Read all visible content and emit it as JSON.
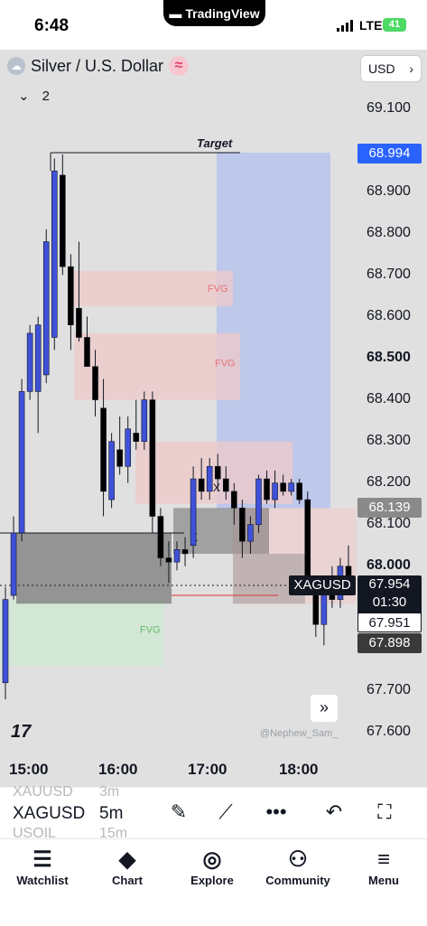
{
  "status_bar": {
    "time": "6:48",
    "app_pill": "TradingView",
    "network": "LTE",
    "battery": "41"
  },
  "chart_header": {
    "symbol_title": "Silver / U.S. Dollar",
    "indicator_count": "2",
    "currency": "USD"
  },
  "price_axis": {
    "labels": [
      "69.100",
      "68.900",
      "68.800",
      "68.700",
      "68.600",
      "68.500",
      "68.400",
      "68.300",
      "68.200",
      "68.100",
      "68.000",
      "67.700",
      "67.600"
    ],
    "tags": {
      "target": "68.994",
      "upper": "68.139",
      "symbol": "XAGUSD",
      "current": "67.954",
      "countdown": "01:30",
      "crosshair": "67.951",
      "lower": "67.898"
    }
  },
  "time_axis": {
    "labels": [
      "15:00",
      "16:00",
      "17:00",
      "18:00"
    ]
  },
  "drawings": {
    "target_label": "Target",
    "fvg_labels": [
      "FVG",
      "FVG",
      "FVG"
    ],
    "x_markers": [
      "X",
      "X"
    ]
  },
  "watermark": "@Nephew_Sam_",
  "toolbar": {
    "symbol": "XAGUSD",
    "interval": "5m",
    "ghost_above_symbol": "XAUUSD",
    "ghost_above_interval": "3m",
    "ghost_below_symbol": "USOIL",
    "ghost_below_interval": "15m"
  },
  "nav": {
    "items": [
      "Watchlist",
      "Chart",
      "Explore",
      "Community",
      "Menu"
    ]
  },
  "colors": {
    "bull": "#3f51d8",
    "bear": "#000000",
    "target_zone": "#b7c3ec",
    "fvg_red": "#efcaca",
    "fvg_green": "#cfe8d3",
    "symbol_tag": "#131722",
    "upper_tag": "#8a8a8a",
    "target_tag": "#2962ff"
  },
  "chart_data": {
    "type": "candlestick",
    "x_ticks": [
      "15:00",
      "16:00",
      "17:00",
      "18:00"
    ],
    "y_range": [
      67.6,
      69.15
    ],
    "candles": [
      {
        "o": 67.72,
        "h": 67.95,
        "l": 67.68,
        "c": 67.92
      },
      {
        "o": 67.93,
        "h": 68.12,
        "l": 67.92,
        "c": 68.08
      },
      {
        "o": 68.08,
        "h": 68.45,
        "l": 68.06,
        "c": 68.42
      },
      {
        "o": 68.42,
        "h": 68.58,
        "l": 68.4,
        "c": 68.56
      },
      {
        "o": 68.42,
        "h": 68.6,
        "l": 68.32,
        "c": 68.58
      },
      {
        "o": 68.46,
        "h": 68.81,
        "l": 68.44,
        "c": 68.78
      },
      {
        "o": 68.55,
        "h": 68.98,
        "l": 68.52,
        "c": 68.95
      },
      {
        "o": 68.94,
        "h": 68.99,
        "l": 68.7,
        "c": 68.72
      },
      {
        "o": 68.72,
        "h": 68.75,
        "l": 68.52,
        "c": 68.58
      },
      {
        "o": 68.62,
        "h": 68.78,
        "l": 68.54,
        "c": 68.55
      },
      {
        "o": 68.55,
        "h": 68.6,
        "l": 68.48,
        "c": 68.48
      },
      {
        "o": 68.48,
        "h": 68.52,
        "l": 68.36,
        "c": 68.4
      },
      {
        "o": 68.38,
        "h": 68.45,
        "l": 68.12,
        "c": 68.18
      },
      {
        "o": 68.16,
        "h": 68.32,
        "l": 68.14,
        "c": 68.3
      },
      {
        "o": 68.28,
        "h": 68.36,
        "l": 68.22,
        "c": 68.24
      },
      {
        "o": 68.24,
        "h": 68.36,
        "l": 68.2,
        "c": 68.33
      },
      {
        "o": 68.32,
        "h": 68.4,
        "l": 68.28,
        "c": 68.3
      },
      {
        "o": 68.3,
        "h": 68.42,
        "l": 68.28,
        "c": 68.4
      },
      {
        "o": 68.4,
        "h": 68.42,
        "l": 68.08,
        "c": 68.12
      },
      {
        "o": 68.12,
        "h": 68.14,
        "l": 68.0,
        "c": 68.02
      },
      {
        "o": 68.02,
        "h": 68.06,
        "l": 67.96,
        "c": 68.01
      },
      {
        "o": 68.01,
        "h": 68.06,
        "l": 67.99,
        "c": 68.04
      },
      {
        "o": 68.04,
        "h": 68.07,
        "l": 68.0,
        "c": 68.03
      },
      {
        "o": 68.05,
        "h": 68.24,
        "l": 68.02,
        "c": 68.21
      },
      {
        "o": 68.21,
        "h": 68.26,
        "l": 68.16,
        "c": 68.18
      },
      {
        "o": 68.18,
        "h": 68.26,
        "l": 68.16,
        "c": 68.24
      },
      {
        "o": 68.24,
        "h": 68.27,
        "l": 68.18,
        "c": 68.21
      },
      {
        "o": 68.21,
        "h": 68.24,
        "l": 68.16,
        "c": 68.18
      },
      {
        "o": 68.18,
        "h": 68.2,
        "l": 68.1,
        "c": 68.14
      },
      {
        "o": 68.14,
        "h": 68.16,
        "l": 68.02,
        "c": 68.06
      },
      {
        "o": 68.06,
        "h": 68.12,
        "l": 68.03,
        "c": 68.1
      },
      {
        "o": 68.1,
        "h": 68.22,
        "l": 68.08,
        "c": 68.21
      },
      {
        "o": 68.21,
        "h": 68.23,
        "l": 68.15,
        "c": 68.16
      },
      {
        "o": 68.16,
        "h": 68.23,
        "l": 68.14,
        "c": 68.2
      },
      {
        "o": 68.2,
        "h": 68.22,
        "l": 68.17,
        "c": 68.18
      },
      {
        "o": 68.18,
        "h": 68.21,
        "l": 68.17,
        "c": 68.2
      },
      {
        "o": 68.2,
        "h": 68.21,
        "l": 68.15,
        "c": 68.16
      },
      {
        "o": 68.16,
        "h": 68.18,
        "l": 67.93,
        "c": 67.95
      },
      {
        "o": 67.95,
        "h": 67.97,
        "l": 67.83,
        "c": 67.86
      },
      {
        "o": 67.86,
        "h": 67.97,
        "l": 67.81,
        "c": 67.96
      },
      {
        "o": 67.96,
        "h": 68.0,
        "l": 67.9,
        "c": 67.92
      },
      {
        "o": 67.92,
        "h": 68.02,
        "l": 67.9,
        "c": 68.0
      },
      {
        "o": 68.0,
        "h": 68.05,
        "l": 67.94,
        "c": 67.96
      }
    ]
  }
}
